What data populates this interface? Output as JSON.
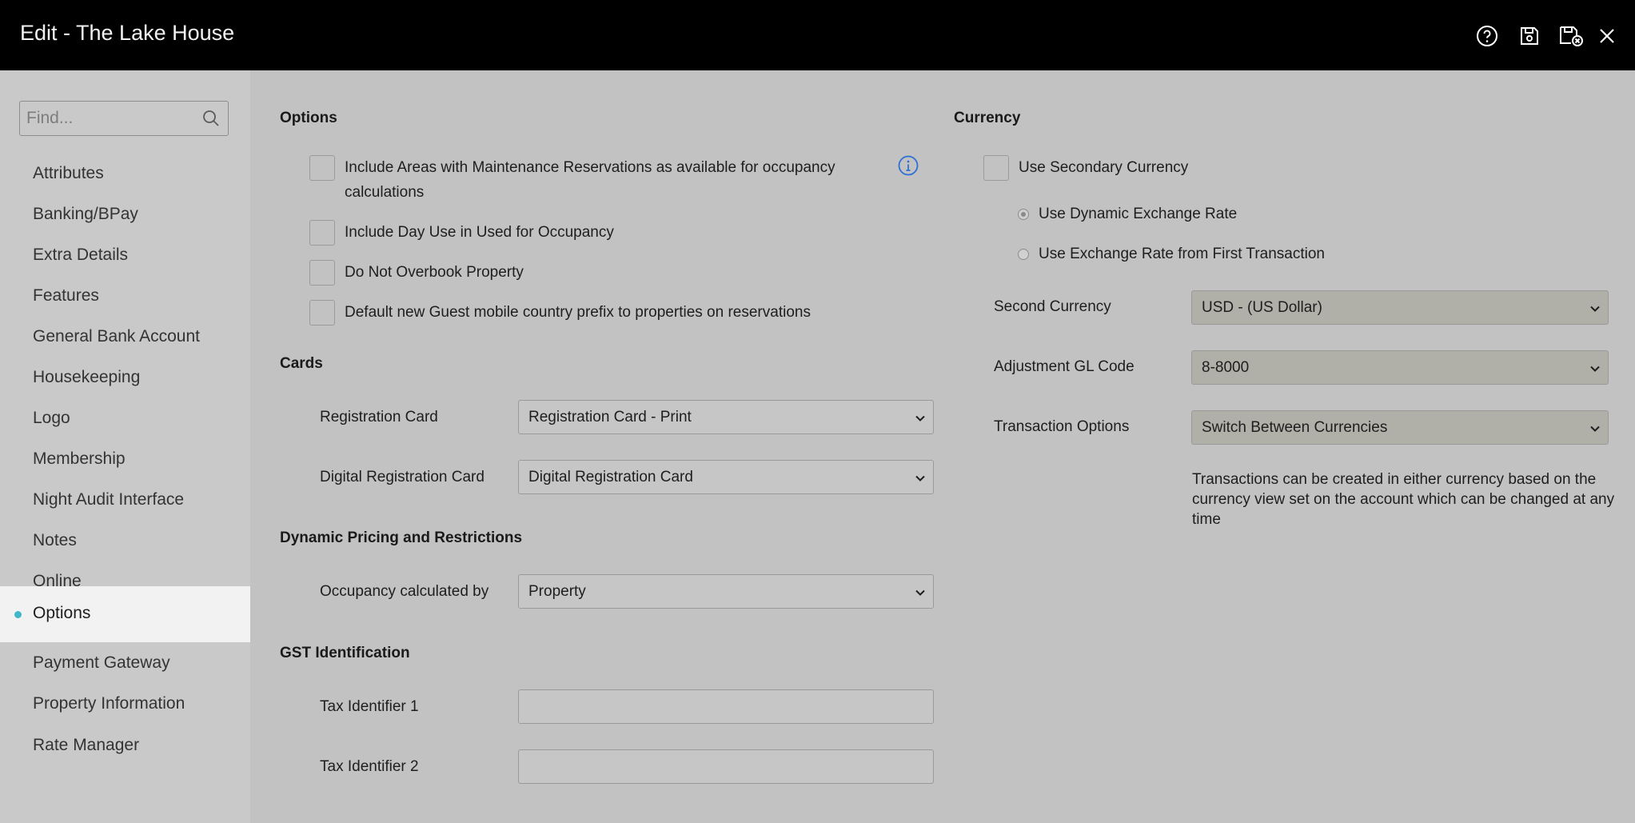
{
  "window": {
    "title": "Edit - The Lake House",
    "icons": [
      "help-icon",
      "save-icon",
      "save-close-icon",
      "close-icon"
    ]
  },
  "sidebar": {
    "search_placeholder": "Find...",
    "items": [
      {
        "label": "Attributes"
      },
      {
        "label": "Banking/BPay"
      },
      {
        "label": "Extra Details"
      },
      {
        "label": "Features"
      },
      {
        "label": "General Bank Account"
      },
      {
        "label": "Housekeeping"
      },
      {
        "label": "Logo"
      },
      {
        "label": "Membership"
      },
      {
        "label": "Night Audit Interface"
      },
      {
        "label": "Notes"
      },
      {
        "label": "Online"
      },
      {
        "label": "Options",
        "active": true
      },
      {
        "label": "Payment Gateway"
      },
      {
        "label": "Property Information"
      },
      {
        "label": "Rate Manager"
      }
    ]
  },
  "options": {
    "title": "Options",
    "checkboxes": [
      {
        "label_line1": "Include Areas with Maintenance Reservations as available for occupancy",
        "label_line2": "calculations",
        "checked": false
      },
      {
        "label": "Include Day Use in Used for Occupancy",
        "checked": false
      },
      {
        "label": "Do Not Overbook Property",
        "checked": false
      },
      {
        "label": "Default new Guest mobile country prefix to properties on reservations",
        "checked": false
      }
    ]
  },
  "cards": {
    "title": "Cards",
    "registration_card_label": "Registration Card",
    "registration_card_value": "Registration Card - Print",
    "digital_card_label": "Digital Registration Card",
    "digital_card_value": "Digital Registration Card"
  },
  "dynamic_pricing": {
    "title": "Dynamic Pricing and Restrictions",
    "occupancy_label": "Occupancy calculated by",
    "occupancy_value": "Property"
  },
  "gst": {
    "title": "GST Identification",
    "tax1_label": "Tax Identifier 1",
    "tax1_value": "",
    "tax2_label": "Tax Identifier 2",
    "tax2_value": ""
  },
  "currency": {
    "title": "Currency",
    "use_secondary_label": "Use Secondary Currency",
    "use_secondary_checked": false,
    "radio_dynamic_label": "Use Dynamic Exchange Rate",
    "radio_first_label": "Use Exchange Rate from First Transaction",
    "selected_radio": "dynamic",
    "second_currency_label": "Second Currency",
    "second_currency_value": "USD - (US Dollar)",
    "adjustment_gl_label": "Adjustment GL Code",
    "adjustment_gl_value": "8-8000",
    "transaction_options_label": "Transaction Options",
    "transaction_options_value": "Switch Between Currencies",
    "help_line1": "Transactions can be created in either currency based on the",
    "help_line2": "currency view set on the account which can be changed at any",
    "help_line3": "time"
  },
  "colors": {
    "topbar": "#000000",
    "overlay_bg": "#c2c2c2",
    "active_item_bg": "#f2f2f2",
    "active_dot": "#3fb8c9",
    "info_icon": "#2f6fd6"
  }
}
